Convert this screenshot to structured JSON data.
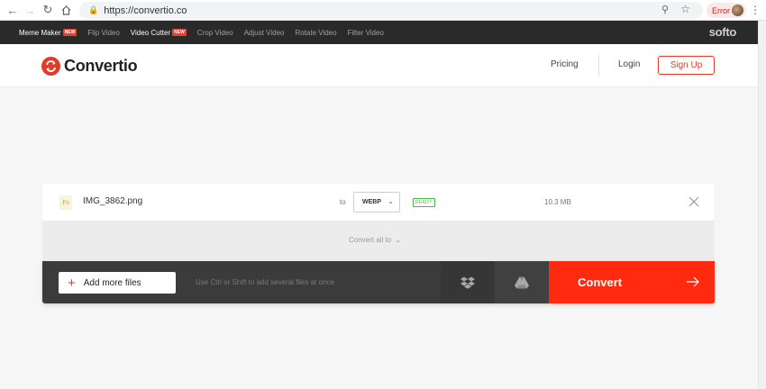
{
  "browser": {
    "url": "https://convertio.co",
    "error_label": "Error"
  },
  "tools_bar": {
    "items": [
      {
        "label": "Meme Maker",
        "badge": "NEW",
        "active": true
      },
      {
        "label": "Flip Video",
        "badge": "",
        "active": false
      },
      {
        "label": "Video Cutter",
        "badge": "NEW",
        "active": true
      },
      {
        "label": "Crop Video",
        "badge": "",
        "active": false
      },
      {
        "label": "Adjust Video",
        "badge": "",
        "active": false
      },
      {
        "label": "Rotate Video",
        "badge": "",
        "active": false
      },
      {
        "label": "Filter Video",
        "badge": "",
        "active": false
      }
    ],
    "brand": "softo"
  },
  "header": {
    "logo_text": "Convertio",
    "pricing": "Pricing",
    "login": "Login",
    "signup": "Sign Up"
  },
  "file": {
    "icon_text": "Pn",
    "name": "IMG_3862.png",
    "to_label": "to",
    "format": "WEBP",
    "status": "READY",
    "size": "10.3 MB"
  },
  "convert_all": {
    "label": "Convert all to"
  },
  "actions": {
    "add_files": "Add more files",
    "hint": "Use Ctrl or Shift to add several files at once",
    "convert": "Convert"
  },
  "colors": {
    "brand_red": "#e23b28",
    "convert_red": "#ff2a0f",
    "ready_green": "#4cb84c",
    "toolbar_dark": "#2a2a2a"
  }
}
